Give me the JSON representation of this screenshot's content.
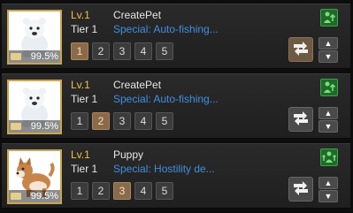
{
  "pets": [
    {
      "level": "Lv.1",
      "name": "CreatePet",
      "tier": "Tier 1",
      "special": "Special: Auto-fishing...",
      "rate": "99.5%",
      "portrait": "polar-bear",
      "skill_buttons": [
        "1",
        "2",
        "3",
        "4",
        "5"
      ],
      "selected_skill": 1,
      "status_icon": "green-person-arrow-up-icon",
      "swap_highlighted": true,
      "up_arrow": "▲",
      "down_arrow": "▼"
    },
    {
      "level": "Lv.1",
      "name": "CreatePet",
      "tier": "Tier 1",
      "special": "Special: Auto-fishing...",
      "rate": "99.5%",
      "portrait": "polar-bear",
      "skill_buttons": [
        "1",
        "2",
        "3",
        "4",
        "5"
      ],
      "selected_skill": 2,
      "status_icon": "green-person-arrow-up-icon",
      "swap_highlighted": false,
      "up_arrow": "▲",
      "down_arrow": "▼"
    },
    {
      "level": "Lv.1",
      "name": "Puppy",
      "tier": "Tier 1",
      "special": "Special: Hostility de...",
      "rate": "99.5%",
      "portrait": "shiba-dog",
      "skill_buttons": [
        "1",
        "2",
        "3",
        "4",
        "5"
      ],
      "selected_skill": 3,
      "status_icon": "green-person-arrows-icon",
      "swap_highlighted": false,
      "up_arrow": "▲",
      "down_arrow": "▼"
    }
  ],
  "colors": {
    "level": "#f0c040",
    "special": "#3f8fe0",
    "selected_skill": "#8a6a48",
    "portrait_border": "#c9a650"
  }
}
